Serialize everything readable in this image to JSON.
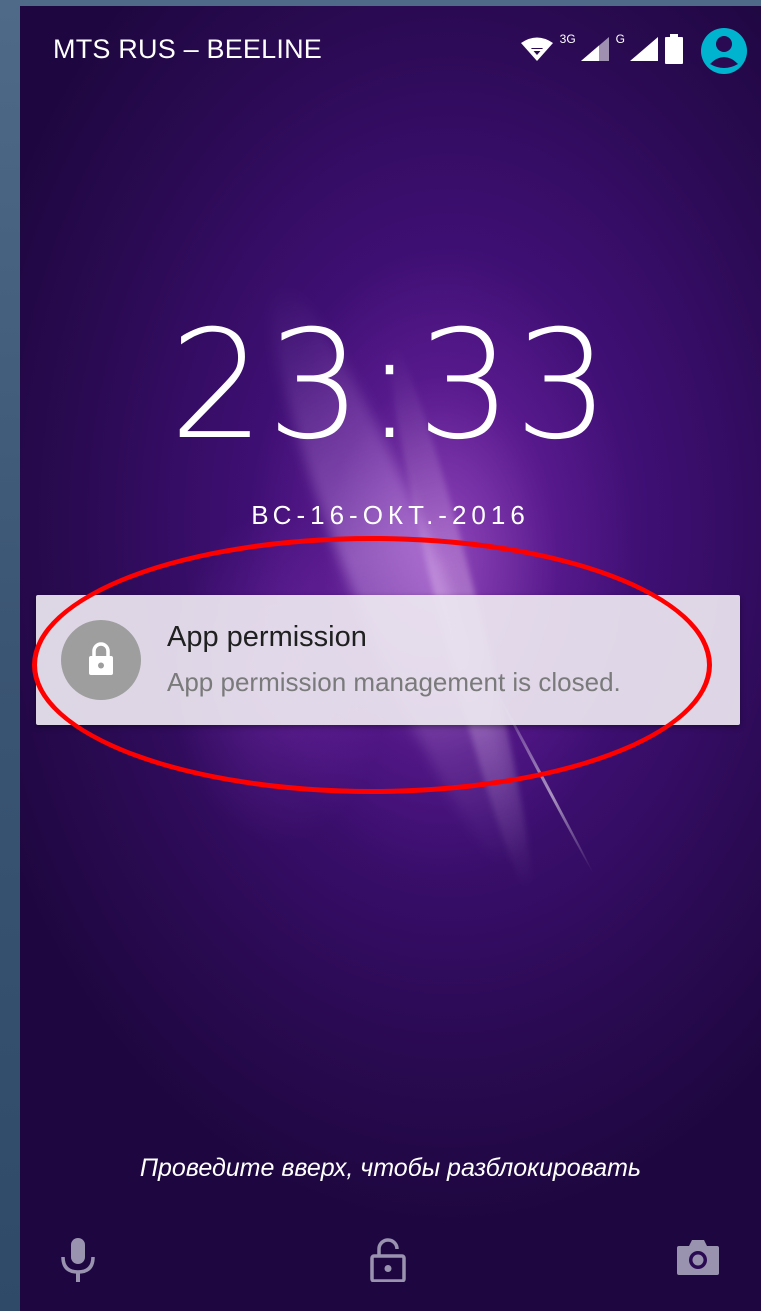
{
  "status_bar": {
    "carrier": "MTS RUS – BEELINE",
    "net_type_1": "3G",
    "net_type_2": "G",
    "icons": [
      "wifi-icon",
      "signal-icon",
      "signal-icon",
      "battery-icon",
      "user-avatar-icon"
    ]
  },
  "lockscreen": {
    "time": "23:33",
    "date": "ВС-16-ОКТ.-2016",
    "unlock_hint": "Проведите вверх, чтобы разблокировать"
  },
  "notification": {
    "icon": "lock-icon",
    "title": "App permission",
    "text": "App permission management is closed."
  },
  "bottom_bar": {
    "icons": [
      "microphone-icon",
      "lock-icon",
      "camera-icon"
    ]
  },
  "colors": {
    "highlight": "#ff0000",
    "avatar": "#00b4d0",
    "notification_bg": "#ece6f0",
    "wallpaper": "#3e0f73"
  }
}
